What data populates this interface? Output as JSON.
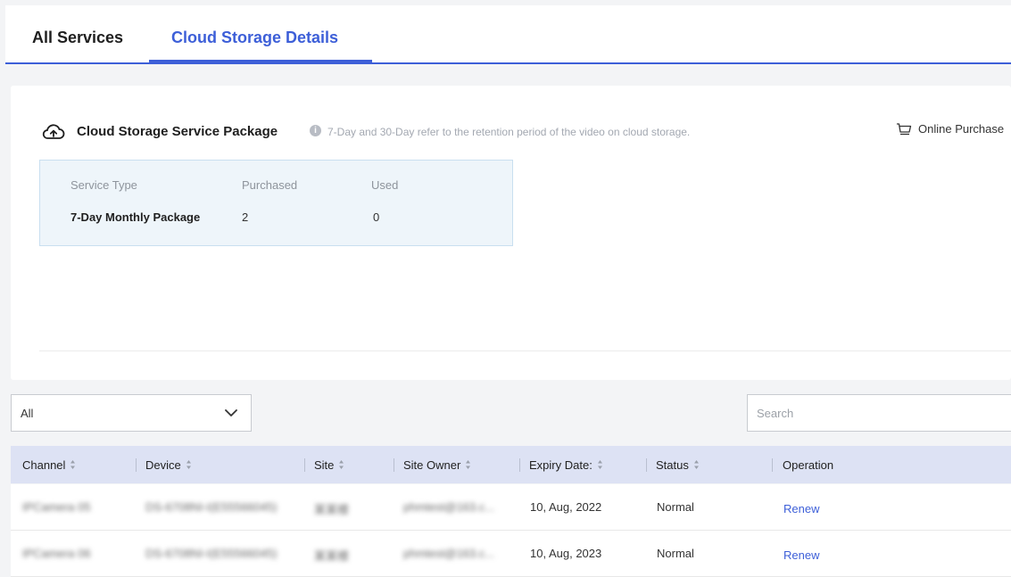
{
  "tabs": [
    {
      "label": "All Services",
      "active": false
    },
    {
      "label": "Cloud Storage Details",
      "active": true
    }
  ],
  "package": {
    "title": "Cloud Storage Service Package",
    "icon": "cloud-upload-icon",
    "note": "7-Day and 30-Day refer to the retention period of the video on cloud storage.",
    "online_purchase_label": "Online Purchase",
    "table": {
      "headers": [
        "Service Type",
        "Purchased",
        "Used"
      ],
      "rows": [
        {
          "service_type": "7-Day Monthly Package",
          "purchased": "2",
          "used": "0"
        }
      ]
    }
  },
  "filter": {
    "selected": "All",
    "search_placeholder": "Search"
  },
  "table": {
    "headers": {
      "channel": "Channel",
      "device": "Device",
      "site": "Site",
      "site_owner": "Site Owner",
      "expiry_date": "Expiry Date:",
      "status": "Status",
      "operation": "Operation"
    },
    "rows": [
      {
        "channel": "IPCamera 05",
        "device": "DS-6708NI-I(E55566045)",
        "site": "某某楼",
        "site_owner": "phmtest@163.c...",
        "expiry_date": "10, Aug, 2022",
        "status": "Normal",
        "operation": "Renew"
      },
      {
        "channel": "IPCamera 06",
        "device": "DS-6708NI-I(E55566045)",
        "site": "某某楼",
        "site_owner": "phmtest@163.c...",
        "expiry_date": "10, Aug, 2023",
        "status": "Normal",
        "operation": "Renew"
      }
    ]
  },
  "colors": {
    "accent": "#3d5fd8",
    "header_bg": "#dde2f4",
    "package_table_bg": "#eef5fa"
  }
}
